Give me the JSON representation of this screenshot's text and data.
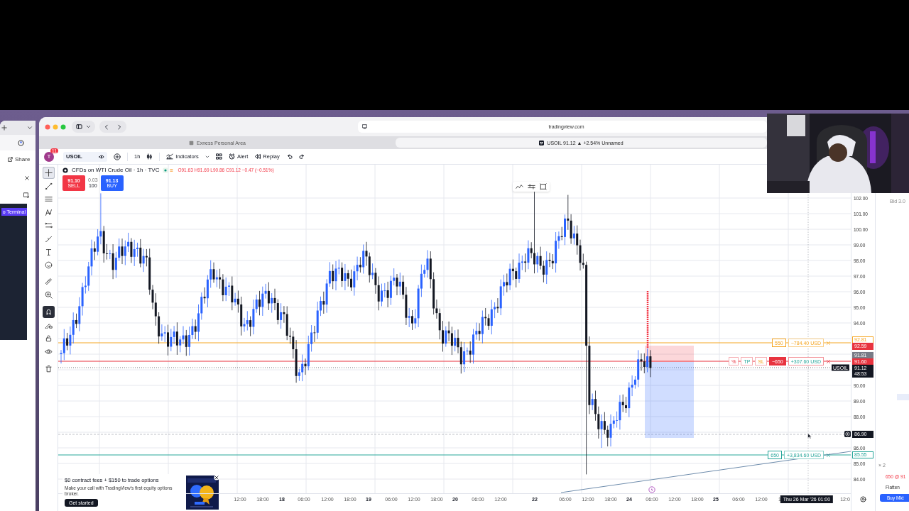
{
  "side_browser": {
    "share_button": "Share",
    "preview_button": "o Terminal"
  },
  "browser": {
    "address": "tradingview.com",
    "tabs": [
      {
        "title": "Exness Personal Area",
        "selected": false
      },
      {
        "title": "USOIL 91.12 ▲ +2.54% Unnamed",
        "selected": true
      }
    ]
  },
  "toolbar": {
    "avatar": "T",
    "notifications": "11",
    "symbol": "USOIL",
    "interval": "1h",
    "indicators": "Indicators",
    "alert": "Alert",
    "replay": "Replay"
  },
  "drawing_tools": [
    {
      "kind": "crosshair",
      "selected": true,
      "active": false
    },
    {
      "kind": "trend_line",
      "selected": false,
      "active": false
    },
    {
      "kind": "lines",
      "selected": false,
      "active": false
    },
    {
      "kind": "pattern",
      "selected": false,
      "active": false
    },
    {
      "kind": "channel",
      "selected": false,
      "active": false
    },
    {
      "kind": "brush",
      "selected": false,
      "active": false
    },
    {
      "kind": "text",
      "selected": false,
      "active": false
    },
    {
      "kind": "smiley",
      "selected": false,
      "active": false
    },
    {
      "kind": "ruler",
      "selected": false,
      "active": false
    },
    {
      "kind": "zoom",
      "selected": false,
      "active": false
    },
    {
      "kind": "magnet",
      "selected": false,
      "active": true
    },
    {
      "kind": "pencil",
      "selected": false,
      "active": false
    },
    {
      "kind": "lock",
      "selected": false,
      "active": false
    },
    {
      "kind": "eye",
      "selected": false,
      "active": false
    },
    {
      "kind": "trash",
      "selected": false,
      "active": false
    }
  ],
  "legend": {
    "title": "CFDs on WTI Crude Oil · 1h · TVC",
    "ohlc": "O91.63 H91.69 L90.86 C91.12 −0.47 (−0.51%)"
  },
  "trade_buttons": {
    "sell_price": "91.10",
    "sell": "SELL",
    "spread": "0.03",
    "quantity": "100",
    "buy_price": "91.13",
    "buy": "BUY"
  },
  "price_axis": [
    "102.00",
    "101.00",
    "100.00",
    "99.00",
    "98.00",
    "97.00",
    "96.00",
    "95.00",
    "94.00",
    "90.00",
    "89.00",
    "88.00",
    "86.00",
    "85.00",
    "84.00"
  ],
  "time_axis": [
    {
      "label": "12:00",
      "kind": "time"
    },
    {
      "label": "18:00",
      "kind": "time"
    },
    {
      "label": "18",
      "kind": "day"
    },
    {
      "label": "06:00",
      "kind": "time"
    },
    {
      "label": "12:00",
      "kind": "time"
    },
    {
      "label": "18:00",
      "kind": "time"
    },
    {
      "label": "19",
      "kind": "day"
    },
    {
      "label": "06:00",
      "kind": "time"
    },
    {
      "label": "12:00",
      "kind": "time"
    },
    {
      "label": "18:00",
      "kind": "time"
    },
    {
      "label": "20",
      "kind": "day"
    },
    {
      "label": "06:00",
      "kind": "time"
    },
    {
      "label": "12:00",
      "kind": "time"
    },
    {
      "label": "22",
      "kind": "day"
    },
    {
      "label": "06:00",
      "kind": "time"
    },
    {
      "label": "12:00",
      "kind": "time"
    },
    {
      "label": "18:00",
      "kind": "time"
    },
    {
      "label": "24",
      "kind": "day"
    },
    {
      "label": "06:00",
      "kind": "time"
    },
    {
      "label": "12:00",
      "kind": "time"
    },
    {
      "label": "18:00",
      "kind": "time"
    },
    {
      "label": "25",
      "kind": "day"
    },
    {
      "label": "06:00",
      "kind": "time"
    },
    {
      "label": "12:00",
      "kind": "time"
    },
    {
      "label": "1",
      "kind": "time"
    },
    {
      "label": "12:0",
      "kind": "time"
    }
  ],
  "order_lines": [
    {
      "color": "#f5a623",
      "quantity": "550",
      "pnl": "−784.40 USD",
      "tags": [
        {
          "text": "92.81",
          "color": "#f5a623",
          "kind": "outline"
        },
        {
          "text": "92.59",
          "color": "#e8333f",
          "kind": "solid"
        }
      ]
    },
    {
      "color": "#e8333f",
      "extras": [
        "%",
        "TP",
        "SL"
      ],
      "quantity": "−650",
      "pnl": "+307.60 USD",
      "tags": [
        {
          "text": "91.81",
          "color": "#787b86",
          "kind": "solid"
        },
        {
          "text": "91.60",
          "color": "#e8333f",
          "kind": "solid"
        }
      ]
    },
    {
      "color": "#26a69a",
      "quantity": "650",
      "pnl": "+3,834.60 USD",
      "tags": [
        {
          "text": "85.55",
          "color": "#26a69a",
          "kind": "outline"
        }
      ]
    }
  ],
  "last_price": {
    "symbol": "USOIL",
    "price": "91.12",
    "countdown": "48:53"
  },
  "crosshair": {
    "price": "86.90",
    "time": "Thu 26 Mar '26 01:00"
  },
  "promo": {
    "title": "$0 contract fees + $150 to trade options",
    "text": "Make your call with TradingView's first equity options broker.",
    "button": "Get started"
  },
  "trade_panel": {
    "header": "Bid 3.0",
    "quantity": "× 2",
    "order": "650 @ 91",
    "flatten": "Flatten",
    "buy": "Buy Mkt"
  }
}
